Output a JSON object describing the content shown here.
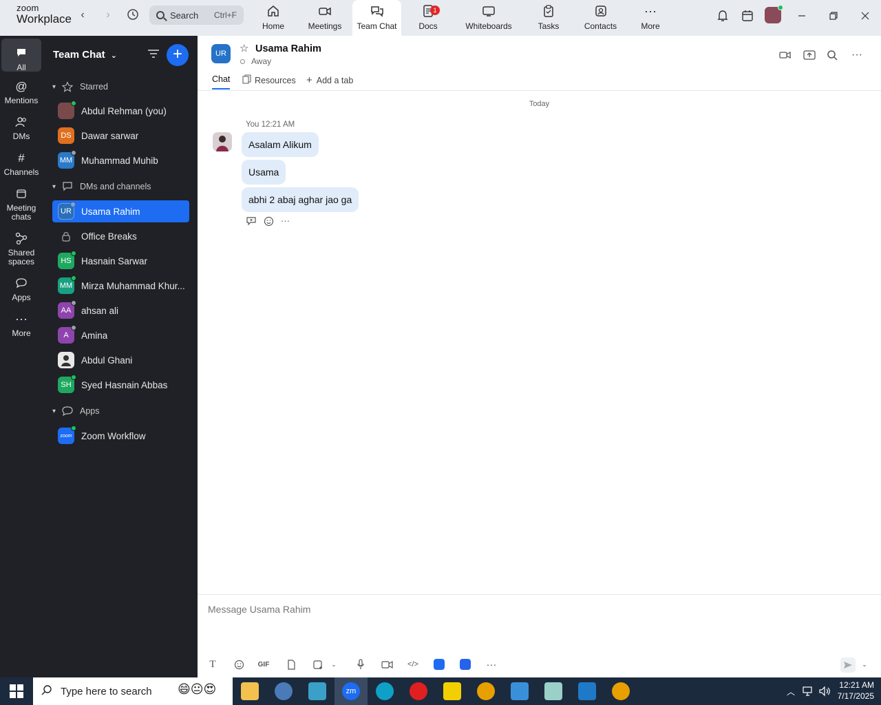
{
  "app": {
    "brand_top": "zoom",
    "brand_bottom": "Workplace"
  },
  "topbar": {
    "search_label": "Search",
    "search_shortcut": "Ctrl+F",
    "tabs": [
      {
        "label": "Home",
        "icon": "home-icon"
      },
      {
        "label": "Meetings",
        "icon": "video-camera-icon"
      },
      {
        "label": "Team Chat",
        "icon": "chat-bubbles-icon"
      },
      {
        "label": "Docs",
        "icon": "document-icon",
        "badge": "1"
      },
      {
        "label": "Whiteboards",
        "icon": "whiteboard-icon"
      },
      {
        "label": "Tasks",
        "icon": "clipboard-icon"
      },
      {
        "label": "Contacts",
        "icon": "contacts-icon"
      },
      {
        "label": "More",
        "icon": "more-dots-icon"
      }
    ],
    "active_tab": "Team Chat"
  },
  "rail": {
    "items": [
      {
        "label": "All",
        "icon": "chat-bubble-icon"
      },
      {
        "label": "Mentions",
        "icon": "at-sign-icon"
      },
      {
        "label": "DMs",
        "icon": "people-icon"
      },
      {
        "label": "Channels",
        "icon": "hash-icon"
      },
      {
        "label": "Meeting chats",
        "icon": "calendar-icon"
      },
      {
        "label": "Shared spaces",
        "icon": "share-nodes-icon"
      },
      {
        "label": "Apps",
        "icon": "app-chat-icon"
      },
      {
        "label": "More",
        "icon": "more-dots-icon"
      }
    ]
  },
  "sidebar": {
    "title": "Team Chat",
    "sections": {
      "starred": "Starred",
      "dms": "DMs and channels",
      "apps": "Apps"
    },
    "starred": [
      {
        "name": "Abdul Rehman (you)",
        "initials": "",
        "color": "#7a4a4a",
        "status": "on"
      },
      {
        "name": "Dawar sarwar",
        "initials": "DS",
        "color": "#e07020",
        "status": "none"
      },
      {
        "name": "Muhammad Muhib",
        "initials": "MM",
        "color": "#2a7ac8",
        "status": "away"
      }
    ],
    "dms": [
      {
        "name": "Usama Rahim",
        "initials": "UR",
        "color": "#2a6fb8",
        "status": "away"
      },
      {
        "name": "Office Breaks",
        "initials": "",
        "color": "",
        "status": "none"
      },
      {
        "name": "Hasnain Sarwar",
        "initials": "HS",
        "color": "#1fa860",
        "status": "on"
      },
      {
        "name": "Mirza Muhammad Khur...",
        "initials": "MM",
        "color": "#18a080",
        "status": "on"
      },
      {
        "name": "ahsan ali",
        "initials": "AA",
        "color": "#8e44ad",
        "status": "away"
      },
      {
        "name": "Amina",
        "initials": "A",
        "color": "#8e44ad",
        "status": "away"
      },
      {
        "name": "Abdul Ghani",
        "initials": "",
        "color": "#e8e8e8",
        "status": "none"
      },
      {
        "name": "Syed Hasnain Abbas",
        "initials": "SH",
        "color": "#1fa860",
        "status": "on"
      }
    ],
    "apps": [
      {
        "name": "Zoom Workflow",
        "initials": "zoom",
        "color": "#1d6cf2",
        "status": "on"
      }
    ]
  },
  "chat": {
    "contact_name": "Usama Rahim",
    "contact_initials": "UR",
    "status": "Away",
    "tabs": [
      "Chat",
      "Resources",
      "Add a tab"
    ],
    "day_label": "Today",
    "sender": "You",
    "time": "12:21 AM",
    "messages": [
      "Asalam Alikum",
      "Usama",
      "abhi 2 abaj aghar jao ga"
    ],
    "composer_placeholder": "Message Usama Rahim"
  },
  "taskbar": {
    "search_placeholder": "Type here to search",
    "time": "12:21 AM",
    "date": "7/17/2025"
  },
  "colors": {
    "accent": "#1d6cf2",
    "sidebar_bg": "#1f2126",
    "bubble": "#e1ecfa",
    "online": "#19c35a"
  }
}
